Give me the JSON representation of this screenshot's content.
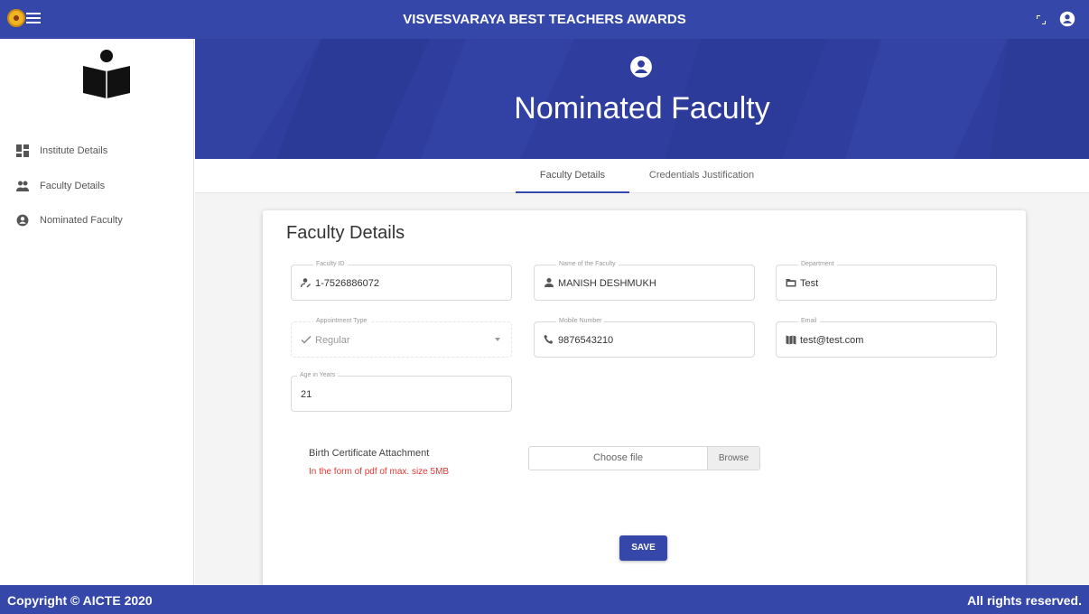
{
  "header": {
    "title": "VISVESVARAYA BEST TEACHERS AWARDS"
  },
  "sidebar": {
    "items": [
      {
        "label": "Institute Details",
        "icon": "dashboard-icon"
      },
      {
        "label": "Faculty Details",
        "icon": "people-icon"
      },
      {
        "label": "Nominated Faculty",
        "icon": "account-circle-icon"
      }
    ]
  },
  "banner": {
    "title": "Nominated Faculty",
    "icon": "account-circle-icon"
  },
  "tabs": [
    {
      "label": "Faculty Details",
      "active": true
    },
    {
      "label": "Credentials Justification",
      "active": false
    }
  ],
  "form": {
    "title": "Faculty Details",
    "fields": {
      "faculty_id": {
        "label": "Faculty ID",
        "value": "1-7526886072"
      },
      "faculty_name": {
        "label": "Name of the Faculty",
        "value": "MANISH DESHMUKH"
      },
      "department": {
        "label": "Department",
        "value": "Test"
      },
      "appointment_type": {
        "label": "Appointment Type",
        "value": "Regular"
      },
      "mobile": {
        "label": "Mobile Number",
        "value": "9876543210"
      },
      "email": {
        "label": "Email",
        "value": "test@test.com"
      },
      "age": {
        "label": "Age in Years",
        "value": "21"
      }
    },
    "attachment": {
      "label": "Birth Certificate Attachment",
      "note": "In the form of pdf of max. size 5MB",
      "placeholder": "Choose file",
      "browse_label": "Browse"
    },
    "save_label": "SAVE"
  },
  "footer": {
    "copyright": "Copyright © AICTE 2020",
    "rights": "All rights reserved."
  },
  "colors": {
    "primary": "#3547a8",
    "banner": "#2f3e9e",
    "error": "#e53935"
  }
}
